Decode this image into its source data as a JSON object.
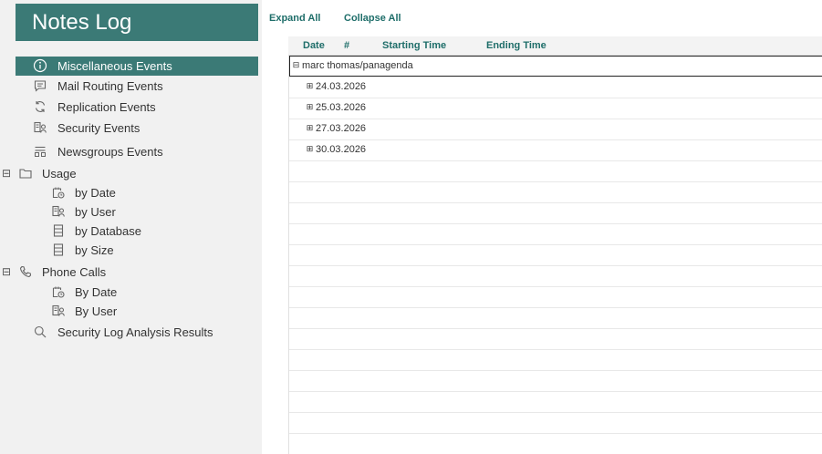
{
  "app": {
    "title": "Notes Log"
  },
  "sidebar": {
    "items": [
      {
        "label": "Miscellaneous Events",
        "icon": "info-icon"
      },
      {
        "label": "Mail Routing Events",
        "icon": "mail-icon"
      },
      {
        "label": "Replication Events",
        "icon": "replication-icon"
      },
      {
        "label": "Security Events",
        "icon": "security-icon"
      },
      {
        "label": "Newsgroups Events",
        "icon": "newsgroups-icon"
      },
      {
        "label": "Usage",
        "icon": "folder-icon",
        "toggle": "⊟"
      },
      {
        "label": "by Date",
        "icon": "calendar-icon"
      },
      {
        "label": "by User",
        "icon": "user-icon"
      },
      {
        "label": "by Database",
        "icon": "database-icon"
      },
      {
        "label": "by Size",
        "icon": "database-icon"
      },
      {
        "label": "Phone Calls",
        "icon": "phone-icon",
        "toggle": "⊟"
      },
      {
        "label": "By Date",
        "icon": "calendar-icon"
      },
      {
        "label": "By User",
        "icon": "user-icon"
      },
      {
        "label": "Security Log Analysis Results",
        "icon": "search-icon"
      }
    ]
  },
  "toolbar": {
    "expand_all": "Expand All",
    "collapse_all": "Collapse All"
  },
  "grid": {
    "columns": [
      "Date",
      "#",
      "Starting Time",
      "Ending Time"
    ],
    "rows": [
      {
        "label": "marc thomas/panagenda",
        "toggle": "⊟"
      },
      {
        "label": "24.03.2026",
        "toggle": "⊞"
      },
      {
        "label": "25.03.2026",
        "toggle": "⊞"
      },
      {
        "label": "27.03.2026",
        "toggle": "⊞"
      },
      {
        "label": "30.03.2026",
        "toggle": "⊞"
      }
    ]
  },
  "colors": {
    "accent": "#3b7a76",
    "link": "#1f6e6a",
    "sidebar_bg": "#f1f1f1"
  }
}
